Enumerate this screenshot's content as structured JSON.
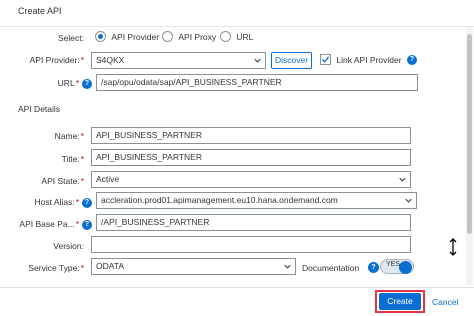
{
  "dialog": {
    "title": "Create API"
  },
  "select": {
    "label": "Select:",
    "options": [
      "API Provider",
      "API Proxy",
      "URL"
    ],
    "selected": "API Provider"
  },
  "api_provider": {
    "label": "API Provider:",
    "value": "S4QKX",
    "discover_label": "Discover",
    "link_label": "Link API Provider",
    "link_checked": true
  },
  "url": {
    "label": "URL",
    "value": "/sap/opu/odata/sap/API_BUSINESS_PARTNER"
  },
  "details": {
    "section_title": "API Details",
    "name_label": "Name:",
    "name_value": "API_BUSINESS_PARTNER",
    "title_label": "Title:",
    "title_value": "API_BUSINESS_PARTNER",
    "state_label": "API State:",
    "state_value": "Active",
    "host_label": "Host Alias:",
    "host_value": "accleration.prod01.apimanagement.eu10.hana.ondemand.com",
    "base_label": "API Base Pa...",
    "base_value": "/API_BUSINESS_PARTNER",
    "version_label": "Version:",
    "version_value": "",
    "service_label": "Service Type:",
    "service_value": "ODATA",
    "documentation_label": "Documentation",
    "documentation_toggle": "YES"
  },
  "footer": {
    "create_label": "Create",
    "cancel_label": "Cancel"
  },
  "colors": {
    "accent": "#0a6ed1",
    "required": "#bb0000",
    "highlight": "#e5344a"
  }
}
